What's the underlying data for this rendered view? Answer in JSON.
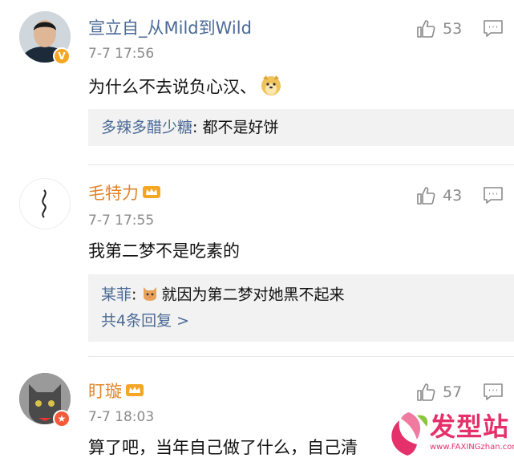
{
  "comments": [
    {
      "author": "宣立自_从Mild到Wild",
      "time": "7-7 17:56",
      "text": "为什么不去说负心汉、",
      "like_count": "53",
      "reply": {
        "user": "多辣多醋少糖",
        "sep": ": ",
        "text": "都不是好饼"
      }
    },
    {
      "author": "毛特力",
      "time": "7-7 17:55",
      "text": "我第二梦不是吃素的",
      "like_count": "43",
      "reply": {
        "user": "某菲",
        "sep": ": ",
        "text": "就因为第二梦对她黑不起来",
        "more": "共4条回复 >"
      }
    },
    {
      "author": "盯璇",
      "time": "7-7 18:03",
      "text": "算了吧，当年自己做了什么，自己清",
      "like_count": "57"
    }
  ],
  "watermark": {
    "brand": "发型站",
    "url": "www.FAXINGzhan.com"
  },
  "colors": {
    "link": "#4a6a96",
    "muted": "#8a8a8a",
    "reply_bg": "#f2f2f2",
    "verified": "#f5a623",
    "crown": "#f5a623"
  }
}
